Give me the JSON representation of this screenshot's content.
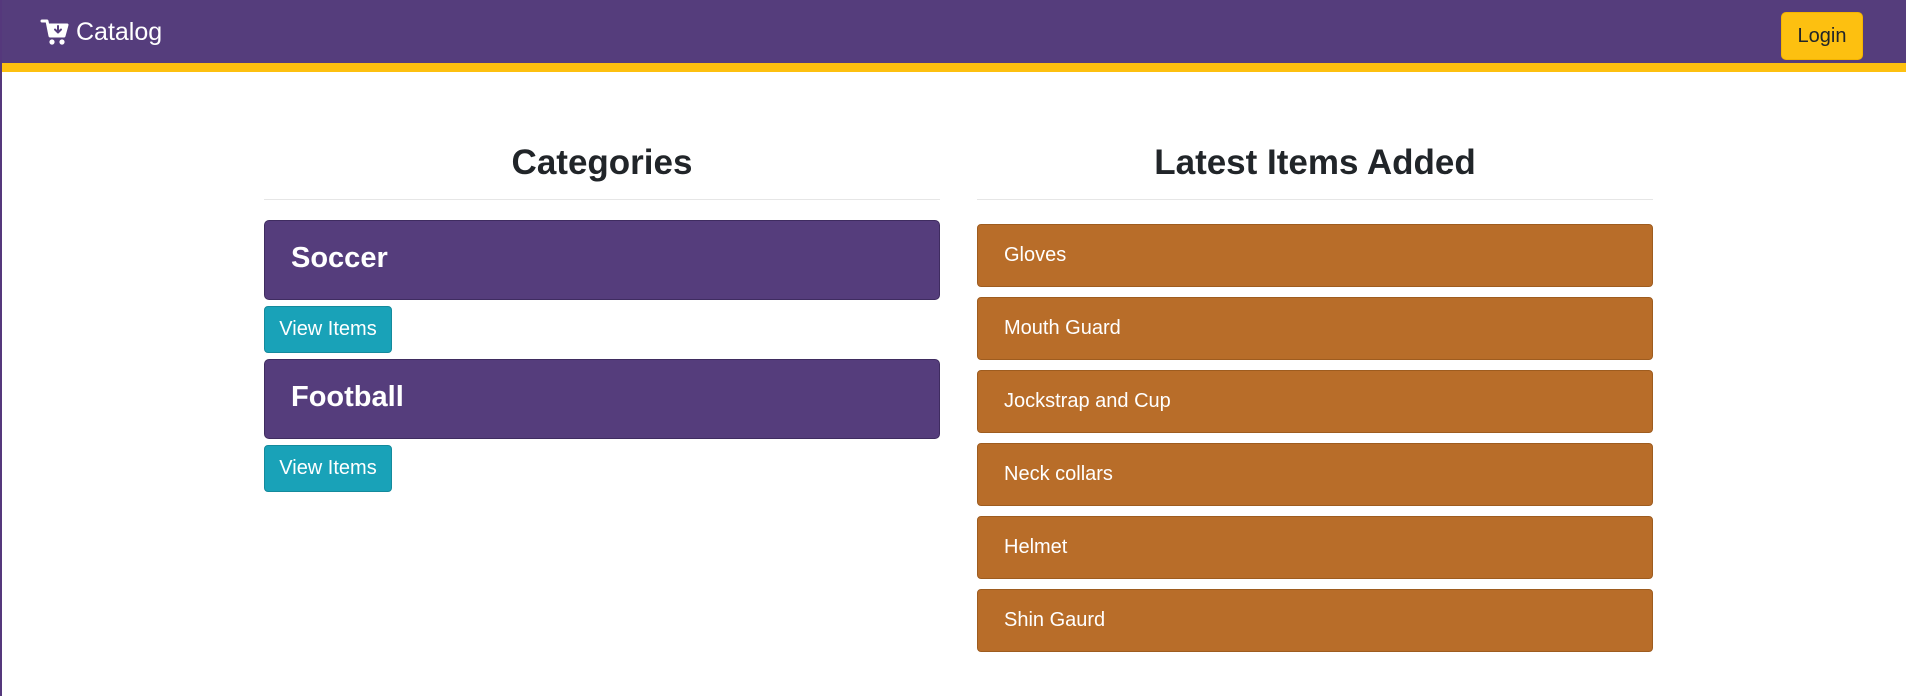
{
  "navbar": {
    "brand_label": "Catalog",
    "brand_icon": "cart-icon",
    "login_label": "Login",
    "colors": {
      "background": "#553d7c",
      "accent": "#fdc010"
    }
  },
  "categories": {
    "title": "Categories",
    "items": [
      {
        "name": "Soccer",
        "button_label": "View Items"
      },
      {
        "name": "Football",
        "button_label": "View Items"
      }
    ],
    "colors": {
      "card": "#553d7c",
      "button": "#19a2b8"
    }
  },
  "latest": {
    "title": "Latest Items Added",
    "items": [
      {
        "name": "Gloves"
      },
      {
        "name": "Mouth Guard"
      },
      {
        "name": "Jockstrap and Cup"
      },
      {
        "name": "Neck collars"
      },
      {
        "name": "Helmet"
      },
      {
        "name": "Shin Gaurd"
      }
    ],
    "colors": {
      "card": "#b86d29"
    }
  }
}
